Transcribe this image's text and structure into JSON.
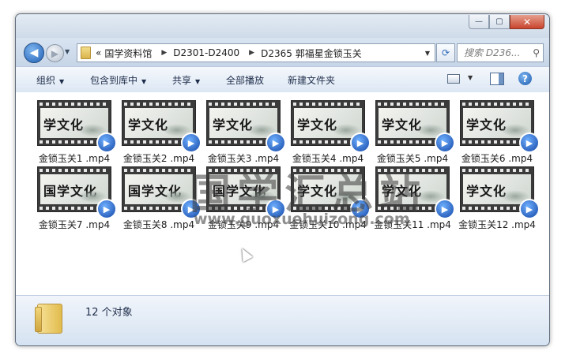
{
  "window": {
    "close_glyph": "✕",
    "max_glyph": "▢",
    "min_glyph": "—"
  },
  "nav": {
    "back_glyph": "◀",
    "forward_glyph": "▶",
    "breadcrumb_prefix": "«",
    "breadcrumbs": [
      "国学资料馆",
      "D2301-D2400",
      "D2365 郭福星金锁玉关"
    ],
    "search_placeholder": "搜索 D236...",
    "search_icon": "search-icon",
    "refresh_icon": "refresh-icon"
  },
  "toolbar": {
    "organize": "组织",
    "include_in_library": "包含到库中",
    "share": "共享",
    "play_all": "全部播放",
    "new_folder": "新建文件夹",
    "help": "?"
  },
  "files": [
    {
      "name": "金锁玉关1  .mp4",
      "thumb": "学文化"
    },
    {
      "name": "金锁玉关2  .mp4",
      "thumb": "学文化"
    },
    {
      "name": "金锁玉关3  .mp4",
      "thumb": "学文化"
    },
    {
      "name": "金锁玉关4  .mp4",
      "thumb": "学文化"
    },
    {
      "name": "金锁玉关5  .mp4",
      "thumb": "学文化"
    },
    {
      "name": "金锁玉关6  .mp4",
      "thumb": "学文化"
    },
    {
      "name": "金锁玉关7  .mp4",
      "thumb": "国学文化"
    },
    {
      "name": "金锁玉关8  .mp4",
      "thumb": "国学文化"
    },
    {
      "name": "金锁玉关9  .mp4",
      "thumb": "国学文化"
    },
    {
      "name": "金锁玉关10 .mp4",
      "thumb": "学文化"
    },
    {
      "name": "金锁玉关11 .mp4",
      "thumb": "学文化"
    },
    {
      "name": "金锁玉关12 .mp4",
      "thumb": "学文化"
    }
  ],
  "watermark": {
    "text": "国学汇总站",
    "url": "www.guoxuehuizong.com"
  },
  "status": {
    "count_text": "12 个对象"
  },
  "colors": {
    "accent": "#1f5fb4",
    "toolbar_text": "#1e2d4a"
  }
}
